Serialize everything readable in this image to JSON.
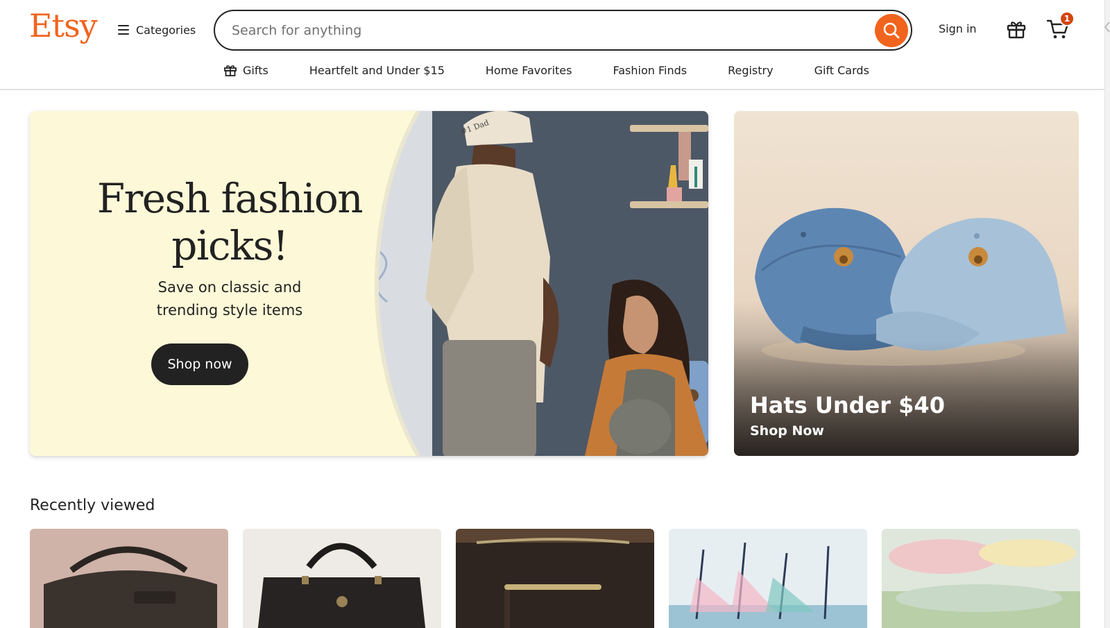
{
  "brand": {
    "logo_text": "Etsy",
    "accent_color": "#f1641e"
  },
  "header": {
    "categories_label": "Categories",
    "search": {
      "placeholder": "Search for anything",
      "value": ""
    },
    "sign_in_label": "Sign in",
    "cart_count": "1"
  },
  "nav": {
    "items": [
      {
        "label": "Gifts",
        "icon": "gift-icon"
      },
      {
        "label": "Heartfelt and Under $15"
      },
      {
        "label": "Home Favorites"
      },
      {
        "label": "Fashion Finds"
      },
      {
        "label": "Registry"
      },
      {
        "label": "Gift Cards"
      }
    ]
  },
  "hero": {
    "title_line1": "Fresh fashion",
    "title_line2": "picks!",
    "subtitle_line1": "Save on classic and",
    "subtitle_line2": "trending style items",
    "button_label": "Shop now",
    "cap_text": "#1 Dad"
  },
  "side_promo": {
    "title": "Hats Under $40",
    "link_label": "Shop Now"
  },
  "recently_viewed": {
    "title": "Recently viewed",
    "items": [
      {
        "kind": "black leather shoulder bag"
      },
      {
        "kind": "black leather satchel"
      },
      {
        "kind": "brown leather crossbody"
      },
      {
        "kind": "sailboat painting"
      },
      {
        "kind": "pastel landscape painting"
      }
    ]
  }
}
